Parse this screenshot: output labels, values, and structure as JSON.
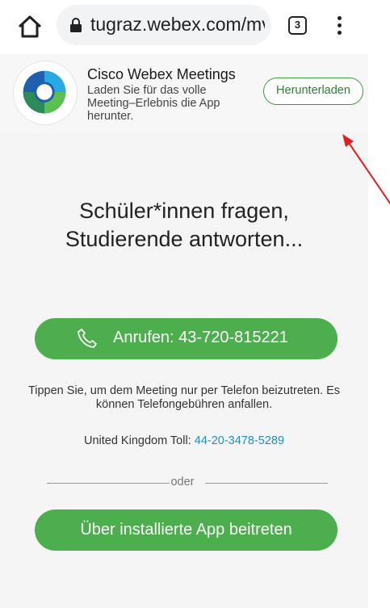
{
  "browser": {
    "url": "tugraz.webex.com/mv",
    "tab_count": "3"
  },
  "banner": {
    "app_name": "Cisco Webex Meetings",
    "description": "Laden Sie für das volle Meeting–Erlebnis die App herunter.",
    "download_label": "Herunterladen"
  },
  "main": {
    "headline": "Schüler*innen fragen, Studierende antworten...",
    "call_label": "Anrufen: 43-720-815221",
    "info_text": "Tippen Sie, um dem Meeting nur per Telefon beizutreten. Es können Telefongebühren anfallen.",
    "toll_label": "United Kingdom Toll:",
    "toll_number": "44-20-3478-5289",
    "or_label": "oder",
    "app_join_label": "Über installierte App beitreten"
  },
  "colors": {
    "accent_green": "#4cae4c",
    "link_blue": "#1e8fbf",
    "annotation_red": "#e02020"
  }
}
